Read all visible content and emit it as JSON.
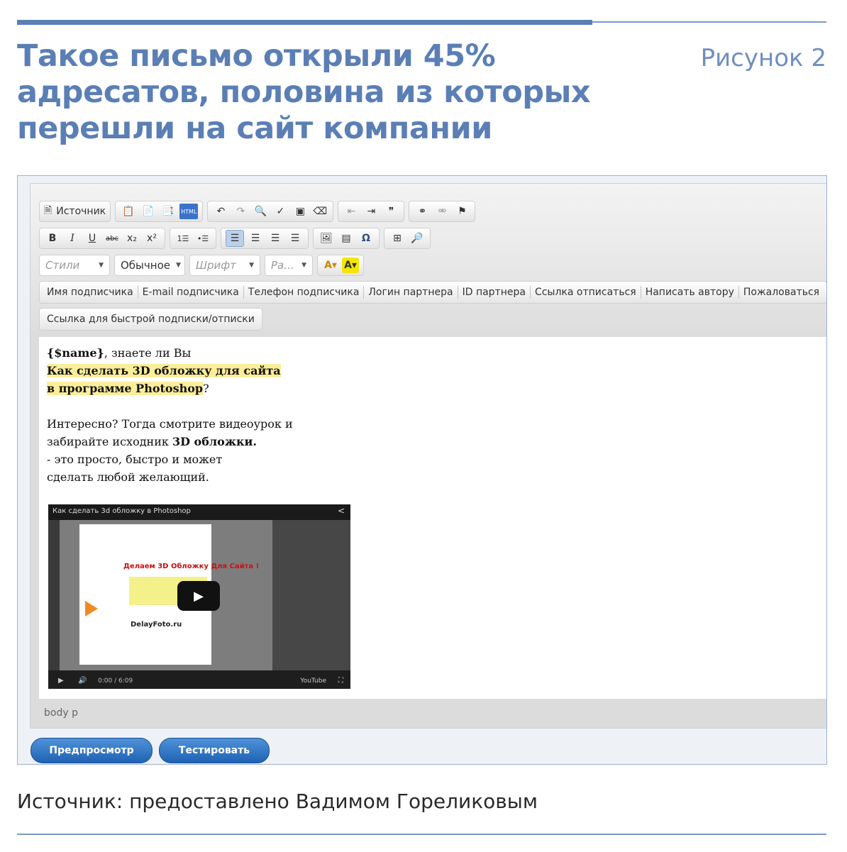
{
  "headline": [
    "Такое письмо открыли 45%",
    "адресатов, половина из которых",
    "перешли на сайт компании"
  ],
  "figure_label": "Рисунок 2",
  "source_caption": "Источник: предоставлено Вадимом Гореликовым",
  "editor": {
    "toolbar": {
      "source_label": "Источник",
      "styles_placeholder": "Стили",
      "format_value": "Обычное",
      "font_placeholder": "Шрифт",
      "size_placeholder": "Ра..."
    },
    "variables": [
      "Имя подписчика",
      "E-mail подписчика",
      "Телефон подписчика",
      "Логин партнера",
      "ID партнера",
      "Ссылка отписаться",
      "Написать автору",
      "Пожаловаться"
    ],
    "quick_link": "Ссылка для быстрой подписки/отписки",
    "content": {
      "name_var": "{$name}",
      "line1_rest": ", знаете ли Вы",
      "highlight1": "Как сделать 3D обложку для сайта",
      "highlight2": "в программе Photoshop",
      "q_mark": "?",
      "p2_line1": "Интересно? Тогда смотрите видеоурок и",
      "p2_line2_a": "забирайте исходник ",
      "p2_line2_b": "3D обложки.",
      "p2_line3": "- это просто, быстро и может",
      "p2_line4": "сделать любой желающий."
    },
    "video": {
      "title": "Как сделать 3d обложку в Photoshop",
      "time": "0:00 / 6:09",
      "thumb_text": "Делаем 3D Обложку Для Сайта !",
      "thumb_logo": "DelayFoto.ru",
      "yt_logo": "YouTube"
    },
    "element_path": "body  p"
  },
  "buttons": {
    "preview": "Предпросмотр",
    "test": "Тестировать"
  },
  "colors": {
    "heading_blue": "#5b7fb5",
    "button_blue": "#1f62b3",
    "highlight": "#fbee9a"
  }
}
